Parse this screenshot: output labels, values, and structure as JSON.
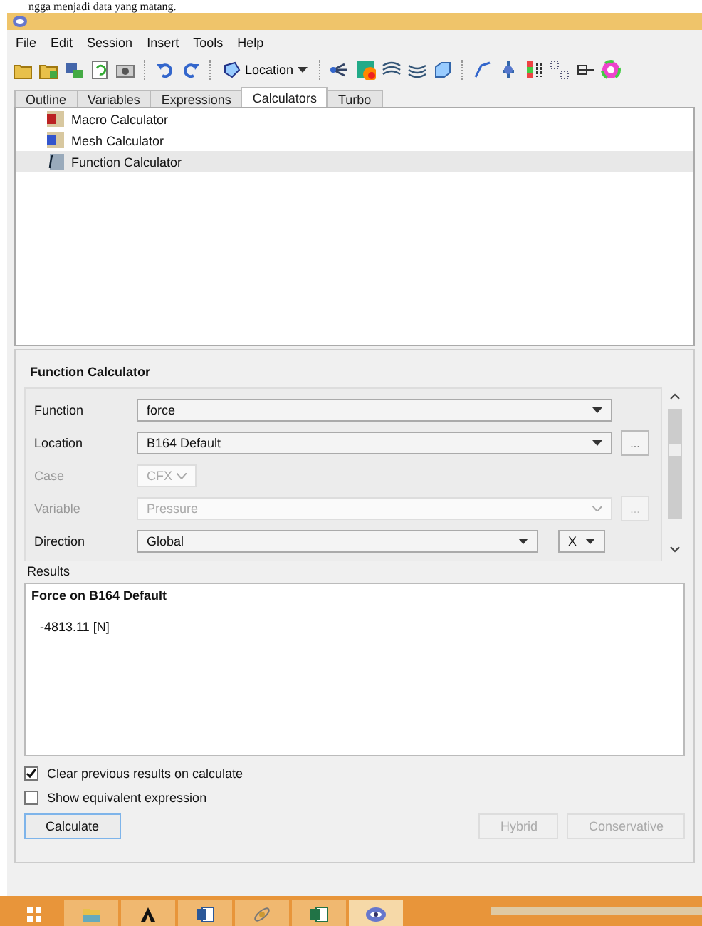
{
  "document_text": "ngga menjadi data yang matang.",
  "menu": [
    "File",
    "Edit",
    "Session",
    "Insert",
    "Tools",
    "Help"
  ],
  "toolbar": {
    "location_button": "Location"
  },
  "tabs": [
    {
      "label": "Outline",
      "selected": false
    },
    {
      "label": "Variables",
      "selected": false
    },
    {
      "label": "Expressions",
      "selected": false
    },
    {
      "label": "Calculators",
      "selected": true
    },
    {
      "label": "Turbo",
      "selected": false
    }
  ],
  "tree": [
    {
      "label": "Macro Calculator",
      "kind": "macro",
      "selected": false
    },
    {
      "label": "Mesh Calculator",
      "kind": "mesh",
      "selected": false
    },
    {
      "label": "Function Calculator",
      "kind": "function",
      "selected": true
    }
  ],
  "panel": {
    "title": "Function Calculator",
    "fields": [
      {
        "label": "Function",
        "value": "force",
        "kind": "plain",
        "disabled": false
      },
      {
        "label": "Location",
        "value": "B164 Default",
        "kind": "browse",
        "browse_label": "...",
        "disabled": false
      },
      {
        "label": "Case",
        "value": "CFX",
        "kind": "small",
        "disabled": true
      },
      {
        "label": "Variable",
        "value": "Pressure",
        "kind": "browse",
        "browse_label": "...",
        "disabled": true
      },
      {
        "label": "Direction",
        "value": "Global",
        "kind": "axis",
        "axis": "X",
        "disabled": false
      }
    ],
    "results_label": "Results",
    "results_title": "Force on B164 Default",
    "results_value": "-4813.11 [N]",
    "options": [
      {
        "label": "Clear previous results on calculate",
        "checked": true
      },
      {
        "label": "Show equivalent expression",
        "checked": false
      }
    ],
    "buttons": [
      {
        "label": "Calculate",
        "disabled": false
      },
      {
        "label": "Hybrid",
        "disabled": true
      },
      {
        "label": "Conservative",
        "disabled": true
      }
    ]
  },
  "taskbar": [
    {
      "kind": "start",
      "selected": false
    },
    {
      "kind": "folder",
      "selected": false
    },
    {
      "kind": "chevron",
      "selected": false
    },
    {
      "kind": "word",
      "selected": false
    },
    {
      "kind": "satellite",
      "selected": false
    },
    {
      "kind": "excel",
      "selected": false
    },
    {
      "kind": "eye",
      "selected": true
    }
  ]
}
